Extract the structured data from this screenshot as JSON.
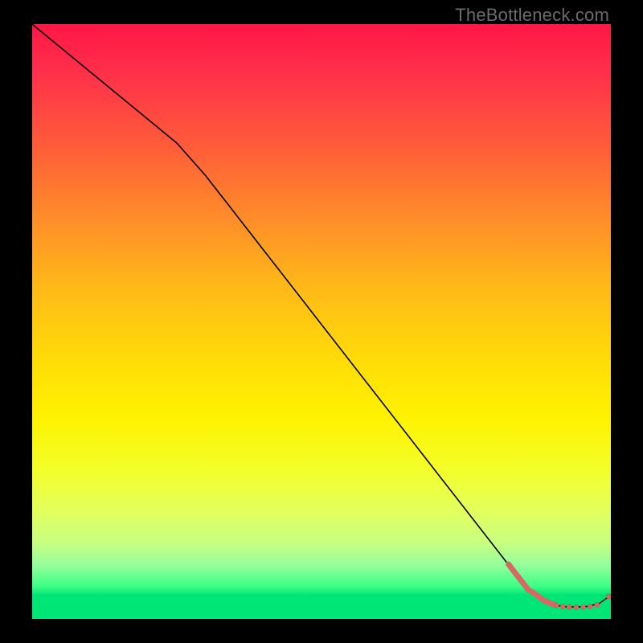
{
  "watermark": "TheBottleneck.com",
  "colors": {
    "curve": "#000000",
    "marker": "#d46a63",
    "gradient_top": "#ff1744",
    "gradient_mid": "#fff200",
    "gradient_bottom": "#00e676",
    "frame": "#000000"
  },
  "chart_data": {
    "type": "line",
    "title": "",
    "xlabel": "",
    "ylabel": "",
    "xlim": [
      0,
      100
    ],
    "ylim": [
      0,
      100
    ],
    "grid": false,
    "series": [
      {
        "name": "bottleneck-curve",
        "x": [
          0,
          10,
          20,
          25,
          30,
          40,
          50,
          60,
          70,
          80,
          84,
          88,
          90,
          92,
          94,
          96,
          98,
          100
        ],
        "y": [
          100,
          92,
          84,
          80,
          74.5,
          62,
          49.5,
          37,
          24.5,
          12,
          7,
          3.2,
          2.4,
          2.05,
          2.0,
          2.1,
          2.6,
          4.0
        ]
      }
    ],
    "markers": [
      {
        "kind": "line",
        "x1": 82.3,
        "y1": 9.2,
        "x2": 85.8,
        "y2": 4.8
      },
      {
        "kind": "line",
        "x1": 86.3,
        "y1": 4.6,
        "x2": 88.6,
        "y2": 3.0
      },
      {
        "kind": "line",
        "x1": 88.8,
        "y1": 2.95,
        "x2": 90.2,
        "y2": 2.4
      },
      {
        "kind": "dot",
        "x": 90.6,
        "y": 2.3,
        "r": 3.2
      },
      {
        "kind": "dot",
        "x": 91.7,
        "y": 2.12,
        "r": 3.2
      },
      {
        "kind": "dot",
        "x": 92.8,
        "y": 2.02,
        "r": 3.2
      },
      {
        "kind": "dot",
        "x": 94.0,
        "y": 1.98,
        "r": 3.2
      },
      {
        "kind": "dot",
        "x": 95.2,
        "y": 2.02,
        "r": 3.2
      },
      {
        "kind": "dot",
        "x": 96.4,
        "y": 2.12,
        "r": 3.2
      },
      {
        "kind": "dot",
        "x": 97.6,
        "y": 2.4,
        "r": 3.2
      },
      {
        "kind": "dot",
        "x": 99.6,
        "y": 3.8,
        "r": 3.2
      }
    ]
  }
}
